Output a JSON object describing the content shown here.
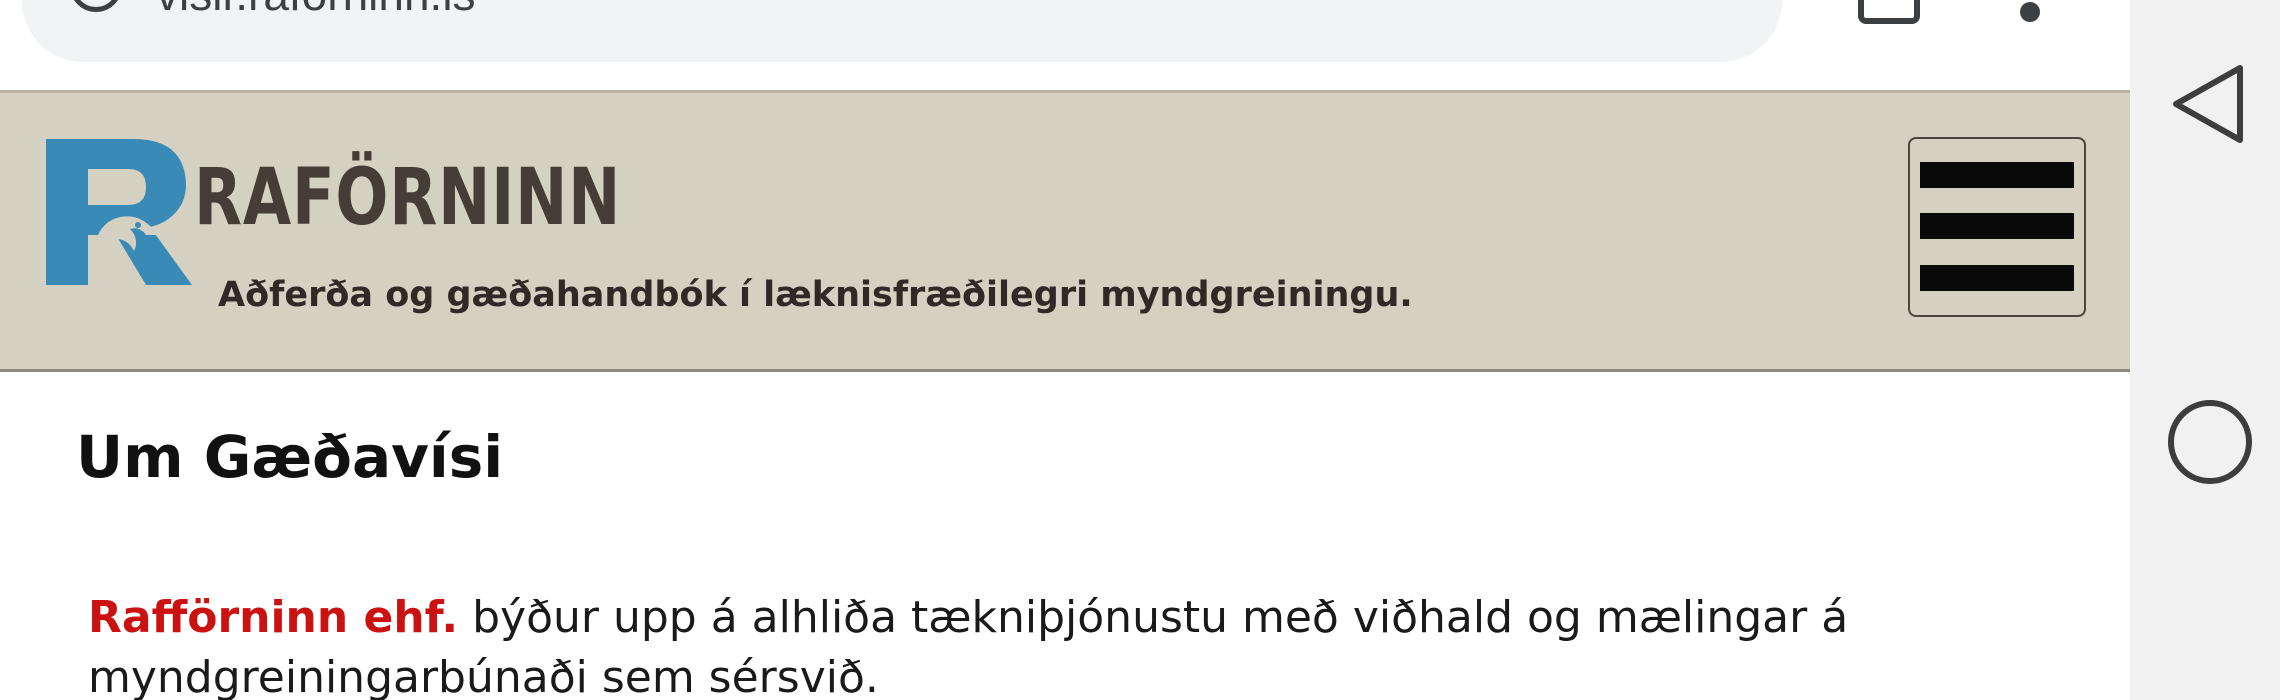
{
  "browser": {
    "url": "visir.raforninn.is"
  },
  "site": {
    "logo_letter": "R",
    "brand_name": "RAFÖRNINN",
    "tagline": "Aðferða og gæðahandbók í læknisfræðilegri myndgreiningu.",
    "menu_icon": "hamburger-icon",
    "colors": {
      "header_bg": "#d4d0c2",
      "logo_blue": "#3a8ab8",
      "brand_text": "#453d36",
      "accent_red": "#cc1111"
    }
  },
  "content": {
    "heading": "Um Gæðavísi",
    "intro_company": "Rafförninn ehf.",
    "intro_text": " býður upp á alhliða tækniþjónustu með viðhald og mælingar á myndgreiningarbúnaði sem sérsvið."
  },
  "system_nav": {
    "back_icon": "back-triangle-icon",
    "home_icon": "home-circle-icon"
  }
}
